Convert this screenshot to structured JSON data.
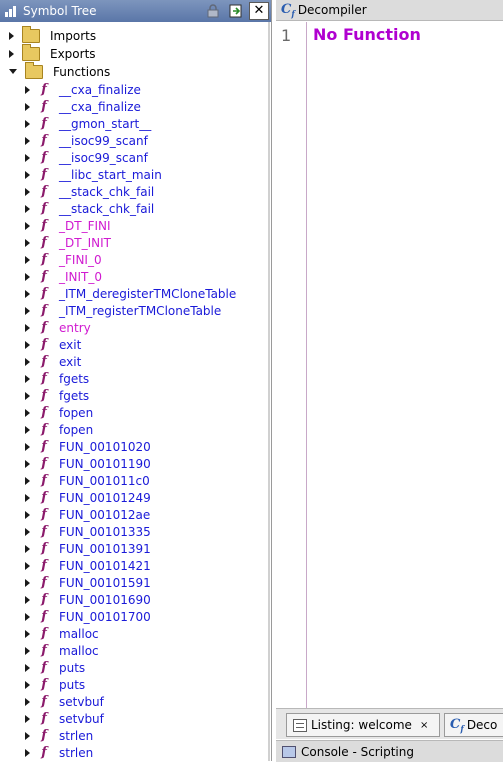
{
  "symbol_tree": {
    "title": "Symbol Tree",
    "close_glyph": "✕",
    "categories": [
      {
        "label": "Imports",
        "expanded": false
      },
      {
        "label": "Exports",
        "expanded": false
      },
      {
        "label": "Functions",
        "expanded": true
      }
    ],
    "functions": [
      {
        "label": "__cxa_finalize",
        "color": "blue",
        "icon": "thunk-function-icon"
      },
      {
        "label": "__cxa_finalize",
        "color": "blue",
        "icon": "thunk-function-icon"
      },
      {
        "label": "__gmon_start__",
        "color": "blue",
        "icon": "thunk-function-icon"
      },
      {
        "label": "__isoc99_scanf",
        "color": "blue",
        "icon": "thunk-function-icon"
      },
      {
        "label": "__isoc99_scanf",
        "color": "blue",
        "icon": "thunk-function-icon"
      },
      {
        "label": "__libc_start_main",
        "color": "blue",
        "icon": "thunk-function-icon"
      },
      {
        "label": "__stack_chk_fail",
        "color": "blue",
        "icon": "thunk-function-icon"
      },
      {
        "label": "__stack_chk_fail",
        "color": "blue",
        "icon": "thunk-function-icon"
      },
      {
        "label": "_DT_FINI",
        "color": "pink",
        "icon": "function-icon"
      },
      {
        "label": "_DT_INIT",
        "color": "pink",
        "icon": "function-icon"
      },
      {
        "label": "_FINI_0",
        "color": "pink",
        "icon": "function-icon"
      },
      {
        "label": "_INIT_0",
        "color": "pink",
        "icon": "function-icon"
      },
      {
        "label": "_ITM_deregisterTMCloneTable",
        "color": "blue",
        "icon": "thunk-function-icon"
      },
      {
        "label": "_ITM_registerTMCloneTable",
        "color": "blue",
        "icon": "thunk-function-icon"
      },
      {
        "label": "entry",
        "color": "pink",
        "icon": "function-icon"
      },
      {
        "label": "exit",
        "color": "blue",
        "icon": "thunk-function-icon"
      },
      {
        "label": "exit",
        "color": "blue",
        "icon": "thunk-function-icon"
      },
      {
        "label": "fgets",
        "color": "blue",
        "icon": "thunk-function-icon"
      },
      {
        "label": "fgets",
        "color": "blue",
        "icon": "thunk-function-icon"
      },
      {
        "label": "fopen",
        "color": "blue",
        "icon": "thunk-function-icon"
      },
      {
        "label": "fopen",
        "color": "blue",
        "icon": "thunk-function-icon"
      },
      {
        "label": "FUN_00101020",
        "color": "blue",
        "icon": "function-icon"
      },
      {
        "label": "FUN_00101190",
        "color": "blue",
        "icon": "function-icon"
      },
      {
        "label": "FUN_001011c0",
        "color": "blue",
        "icon": "function-icon"
      },
      {
        "label": "FUN_00101249",
        "color": "blue",
        "icon": "function-icon"
      },
      {
        "label": "FUN_001012ae",
        "color": "blue",
        "icon": "function-icon"
      },
      {
        "label": "FUN_00101335",
        "color": "blue",
        "icon": "function-icon"
      },
      {
        "label": "FUN_00101391",
        "color": "blue",
        "icon": "function-icon"
      },
      {
        "label": "FUN_00101421",
        "color": "blue",
        "icon": "function-icon"
      },
      {
        "label": "FUN_00101591",
        "color": "blue",
        "icon": "function-icon"
      },
      {
        "label": "FUN_00101690",
        "color": "blue",
        "icon": "function-icon"
      },
      {
        "label": "FUN_00101700",
        "color": "blue",
        "icon": "function-icon"
      },
      {
        "label": "malloc",
        "color": "blue",
        "icon": "thunk-function-icon"
      },
      {
        "label": "malloc",
        "color": "blue",
        "icon": "thunk-function-icon"
      },
      {
        "label": "puts",
        "color": "blue",
        "icon": "thunk-function-icon"
      },
      {
        "label": "puts",
        "color": "blue",
        "icon": "thunk-function-icon"
      },
      {
        "label": "setvbuf",
        "color": "blue",
        "icon": "thunk-function-icon"
      },
      {
        "label": "setvbuf",
        "color": "blue",
        "icon": "thunk-function-icon"
      },
      {
        "label": "strlen",
        "color": "blue",
        "icon": "thunk-function-icon"
      },
      {
        "label": "strlen",
        "color": "blue",
        "icon": "thunk-function-icon"
      }
    ]
  },
  "decompiler": {
    "title": "Decompiler",
    "line_number": "1",
    "content": "No Function"
  },
  "tabs": {
    "listing_label": "Listing: welcome",
    "close_glyph": "×",
    "decompiler_label": "Deco"
  },
  "console": {
    "title": "Console - Scripting"
  },
  "colors": {
    "blue": "#1a1ad8",
    "pink": "#d01ad0",
    "no_function": "#b000d0"
  }
}
